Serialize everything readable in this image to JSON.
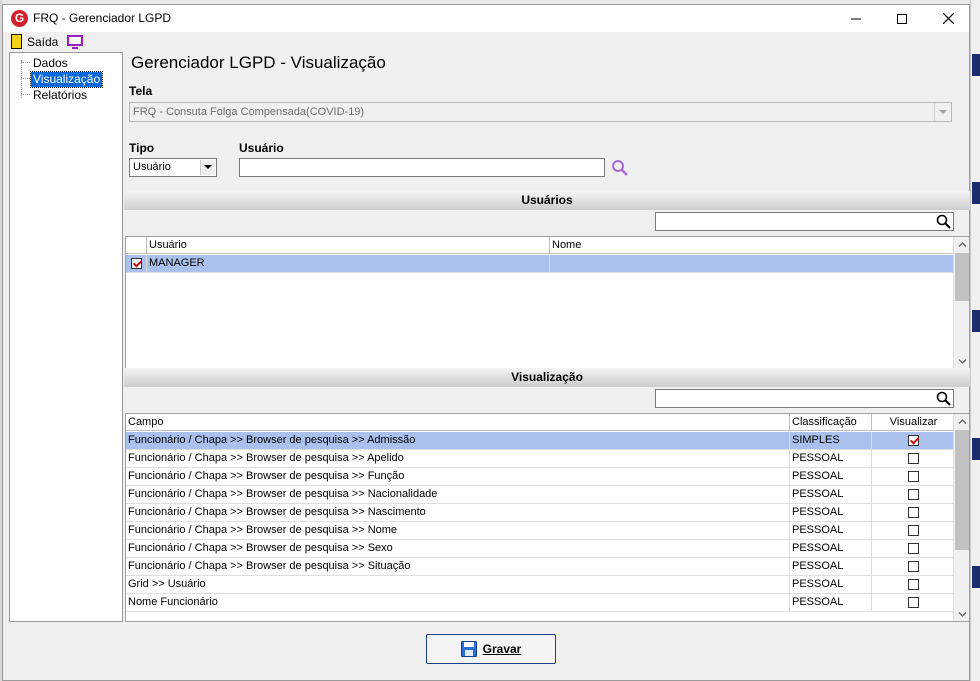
{
  "window": {
    "title": "FRQ - Gerenciador LGPD",
    "app_icon_letter": "G"
  },
  "toolbar": {
    "exit_label": "Saída"
  },
  "sidebar": {
    "items": [
      {
        "label": "Dados",
        "selected": false
      },
      {
        "label": "Visualização",
        "selected": true
      },
      {
        "label": "Relatórios",
        "selected": false
      }
    ]
  },
  "main": {
    "page_title": "Gerenciador LGPD - Visualização",
    "tela_label": "Tela",
    "tela_value": "FRQ - Consuta Folga Compensada(COVID-19)",
    "tipo_label": "Tipo",
    "tipo_value": "Usuário",
    "usuario_label": "Usuário",
    "usuario_value": ""
  },
  "usuarios": {
    "section_title": "Usuários",
    "filter_value": "",
    "columns": [
      "Usuário",
      "Nome"
    ],
    "rows": [
      {
        "checked": true,
        "usuario": "MANAGER",
        "nome": ""
      }
    ]
  },
  "visualizacao": {
    "section_title": "Visualização",
    "filter_value": "",
    "columns": [
      "Campo",
      "Classificação",
      "Visualizar"
    ],
    "rows": [
      {
        "campo": "Funcionário / Chapa >> Browser de pesquisa >> Admissão",
        "classificacao": "SIMPLES",
        "visualizar": true
      },
      {
        "campo": "Funcionário / Chapa >> Browser de pesquisa >> Apelido",
        "classificacao": "PESSOAL",
        "visualizar": false
      },
      {
        "campo": "Funcionário / Chapa >> Browser de pesquisa >> Função",
        "classificacao": "PESSOAL",
        "visualizar": false
      },
      {
        "campo": "Funcionário / Chapa >> Browser de pesquisa >> Nacionalidade",
        "classificacao": "PESSOAL",
        "visualizar": false
      },
      {
        "campo": "Funcionário / Chapa >> Browser de pesquisa >> Nascimento",
        "classificacao": "PESSOAL",
        "visualizar": false
      },
      {
        "campo": "Funcionário / Chapa >> Browser de pesquisa >> Nome",
        "classificacao": "PESSOAL",
        "visualizar": false
      },
      {
        "campo": "Funcionário / Chapa >> Browser de pesquisa >> Sexo",
        "classificacao": "PESSOAL",
        "visualizar": false
      },
      {
        "campo": "Funcionário / Chapa >> Browser de pesquisa >> Situação",
        "classificacao": "PESSOAL",
        "visualizar": false
      },
      {
        "campo": "Grid >> Usuário",
        "classificacao": "PESSOAL",
        "visualizar": false
      },
      {
        "campo": "Nome Funcionário",
        "classificacao": "PESSOAL",
        "visualizar": false
      }
    ]
  },
  "footer": {
    "save_label": "Gravar"
  },
  "colors": {
    "selected_row": "#a9c1ec",
    "tree_selected": "#0a68d8",
    "save_button_border": "#1f3f8a",
    "check_mark": "#d01010"
  }
}
